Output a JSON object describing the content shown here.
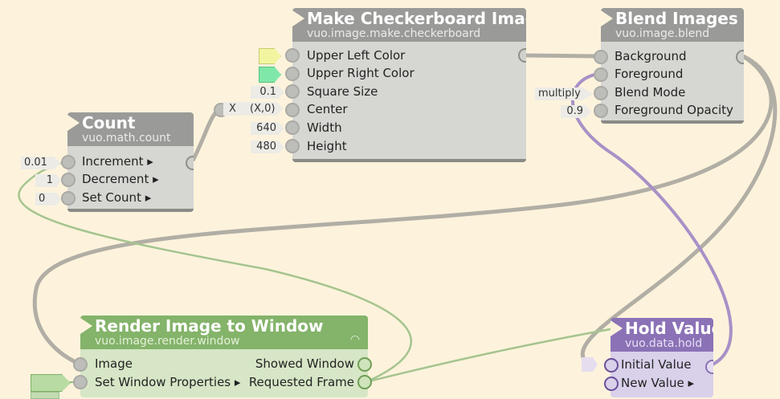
{
  "nodes": {
    "checkerboard": {
      "title": "Make Checkerboard Image",
      "subtitle": "vuo.image.make.checkerboard",
      "inputs": [
        "Upper Left Color",
        "Upper Right Color",
        "Square Size",
        "Center",
        "Width",
        "Height"
      ],
      "constants": {
        "square_size": "0.1",
        "center_x": "X",
        "center_xy": "(X,0)",
        "width": "640",
        "height": "480"
      },
      "colors": {
        "upper_left": "#f2f5a0",
        "upper_right": "#7fe8a8"
      }
    },
    "blend": {
      "title": "Blend Images",
      "subtitle": "vuo.image.blend",
      "inputs": [
        "Background",
        "Foreground",
        "Blend Mode",
        "Foreground Opacity"
      ],
      "constants": {
        "blend_mode": "multiply",
        "opacity": "0.9"
      }
    },
    "count": {
      "title": "Count",
      "subtitle": "vuo.math.count",
      "inputs": [
        "Increment ▸",
        "Decrement ▸",
        "Set Count ▸"
      ],
      "constants": {
        "increment": "0.01",
        "decrement": "1",
        "set_count": "0"
      }
    },
    "render": {
      "title": "Render Image to Window",
      "subtitle": "vuo.image.render.window",
      "inputs": [
        "Image",
        "Set Window Properties ▸"
      ],
      "outputs": [
        "Showed Window",
        "Requested Frame"
      ]
    },
    "hold": {
      "title": "Hold Value",
      "subtitle": "vuo.data.hold",
      "inputs": [
        "Initial Value",
        "New Value ▸"
      ]
    }
  },
  "colors": {
    "canvas": "#fdf3dc",
    "wire_gray": "#b1aea5",
    "wire_green": "#a5c48f",
    "wire_purple": "#a891c7"
  }
}
